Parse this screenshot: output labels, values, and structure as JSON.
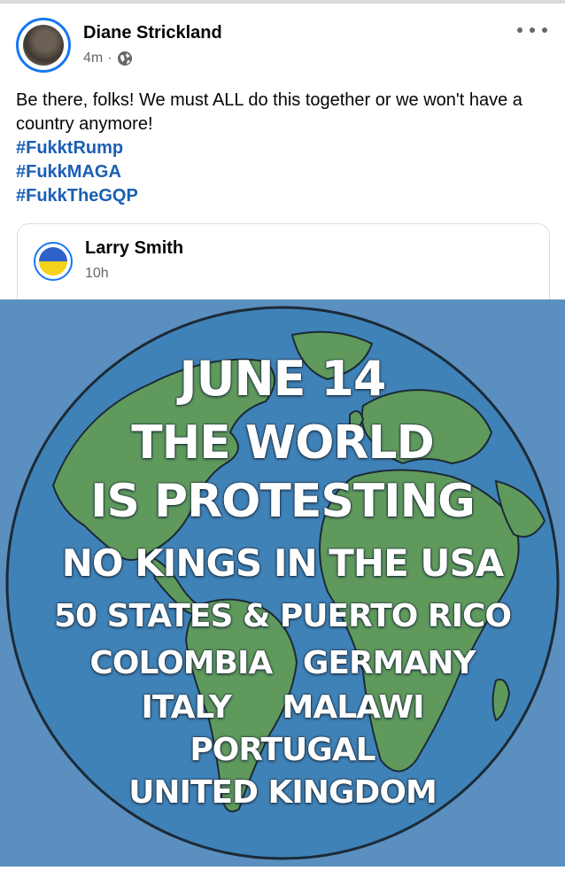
{
  "post": {
    "author": "Diane Strickland",
    "timestamp": "4m",
    "separator": "·",
    "privacy_icon": "globe-icon",
    "more_icon": "more-options-icon",
    "body_text": "Be there, folks! We must ALL do this together or we won't have a country anymore!",
    "hashtags": [
      "#FukktRump",
      "#FukkMAGA",
      "#FukkTheGQP"
    ]
  },
  "shared_post": {
    "author": "Larry Smith",
    "timestamp": "10h",
    "poster_lines": [
      "JUNE 14",
      "THE WORLD",
      "IS PROTESTING",
      "NO KINGS IN THE USA",
      "50 STATES & PUERTO RICO",
      "COLOMBIA   GERMANY",
      "ITALY     MALAWI",
      "PORTUGAL",
      "UNITED KINGDOM"
    ]
  },
  "colors": {
    "accent": "#1877f2",
    "hashtag": "#1a5fb4",
    "poster_background": "#5a8fbf",
    "ocean": "#3f82b8",
    "land": "#5f9a5c",
    "poster_text": "#ffffff"
  }
}
